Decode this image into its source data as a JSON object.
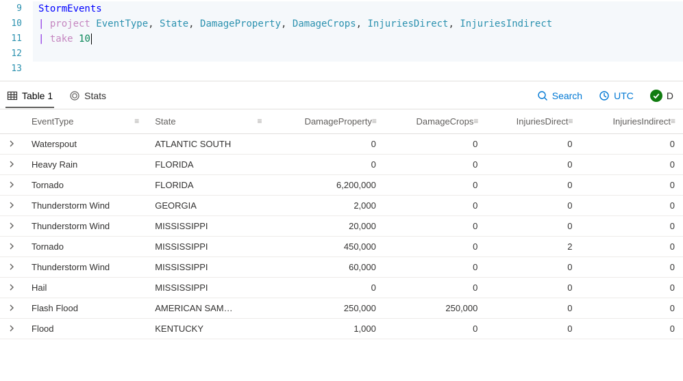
{
  "editor": {
    "lines": [
      {
        "num": "9",
        "tokens": [
          {
            "t": "StormEvents",
            "cls": "tok-table"
          }
        ]
      },
      {
        "num": "10",
        "tokens": [
          {
            "t": "| ",
            "cls": "tok-pipe"
          },
          {
            "t": "project ",
            "cls": "tok-kw"
          },
          {
            "t": "EventType",
            "cls": "tok-col"
          },
          {
            "t": ", ",
            "cls": "tok-plain"
          },
          {
            "t": "State",
            "cls": "tok-col"
          },
          {
            "t": ", ",
            "cls": "tok-plain"
          },
          {
            "t": "DamageProperty",
            "cls": "tok-col"
          },
          {
            "t": ", ",
            "cls": "tok-plain"
          },
          {
            "t": "DamageCrops",
            "cls": "tok-col"
          },
          {
            "t": ", ",
            "cls": "tok-plain"
          },
          {
            "t": "InjuriesDirect",
            "cls": "tok-col"
          },
          {
            "t": ", ",
            "cls": "tok-plain"
          },
          {
            "t": "InjuriesIndirect",
            "cls": "tok-col"
          }
        ]
      },
      {
        "num": "11",
        "tokens": [
          {
            "t": "| ",
            "cls": "tok-pipe"
          },
          {
            "t": "take ",
            "cls": "tok-kw"
          },
          {
            "t": "10",
            "cls": "tok-num"
          }
        ],
        "cursor": true
      },
      {
        "num": "12",
        "tokens": []
      },
      {
        "num": "13",
        "tokens": [],
        "nobg": true
      }
    ]
  },
  "toolbar": {
    "table_label": "Table 1",
    "stats_label": "Stats",
    "search_label": "Search",
    "tz_label": "UTC",
    "done_label": "D"
  },
  "columns": [
    {
      "key": "EventType",
      "label": "EventType",
      "numeric": false
    },
    {
      "key": "State",
      "label": "State",
      "numeric": false
    },
    {
      "key": "DamageProperty",
      "label": "DamageProperty",
      "numeric": true
    },
    {
      "key": "DamageCrops",
      "label": "DamageCrops",
      "numeric": true
    },
    {
      "key": "InjuriesDirect",
      "label": "InjuriesDirect",
      "numeric": true
    },
    {
      "key": "InjuriesIndirect",
      "label": "InjuriesIndirect",
      "numeric": true
    }
  ],
  "rows": [
    {
      "EventType": "Waterspout",
      "State": "ATLANTIC SOUTH",
      "DamageProperty": "0",
      "DamageCrops": "0",
      "InjuriesDirect": "0",
      "InjuriesIndirect": "0"
    },
    {
      "EventType": "Heavy Rain",
      "State": "FLORIDA",
      "DamageProperty": "0",
      "DamageCrops": "0",
      "InjuriesDirect": "0",
      "InjuriesIndirect": "0"
    },
    {
      "EventType": "Tornado",
      "State": "FLORIDA",
      "DamageProperty": "6,200,000",
      "DamageCrops": "0",
      "InjuriesDirect": "0",
      "InjuriesIndirect": "0"
    },
    {
      "EventType": "Thunderstorm Wind",
      "State": "GEORGIA",
      "DamageProperty": "2,000",
      "DamageCrops": "0",
      "InjuriesDirect": "0",
      "InjuriesIndirect": "0"
    },
    {
      "EventType": "Thunderstorm Wind",
      "State": "MISSISSIPPI",
      "DamageProperty": "20,000",
      "DamageCrops": "0",
      "InjuriesDirect": "0",
      "InjuriesIndirect": "0"
    },
    {
      "EventType": "Tornado",
      "State": "MISSISSIPPI",
      "DamageProperty": "450,000",
      "DamageCrops": "0",
      "InjuriesDirect": "2",
      "InjuriesIndirect": "0"
    },
    {
      "EventType": "Thunderstorm Wind",
      "State": "MISSISSIPPI",
      "DamageProperty": "60,000",
      "DamageCrops": "0",
      "InjuriesDirect": "0",
      "InjuriesIndirect": "0"
    },
    {
      "EventType": "Hail",
      "State": "MISSISSIPPI",
      "DamageProperty": "0",
      "DamageCrops": "0",
      "InjuriesDirect": "0",
      "InjuriesIndirect": "0"
    },
    {
      "EventType": "Flash Flood",
      "State": "AMERICAN SAM…",
      "DamageProperty": "250,000",
      "DamageCrops": "250,000",
      "InjuriesDirect": "0",
      "InjuriesIndirect": "0"
    },
    {
      "EventType": "Flood",
      "State": "KENTUCKY",
      "DamageProperty": "1,000",
      "DamageCrops": "0",
      "InjuriesDirect": "0",
      "InjuriesIndirect": "0"
    }
  ]
}
